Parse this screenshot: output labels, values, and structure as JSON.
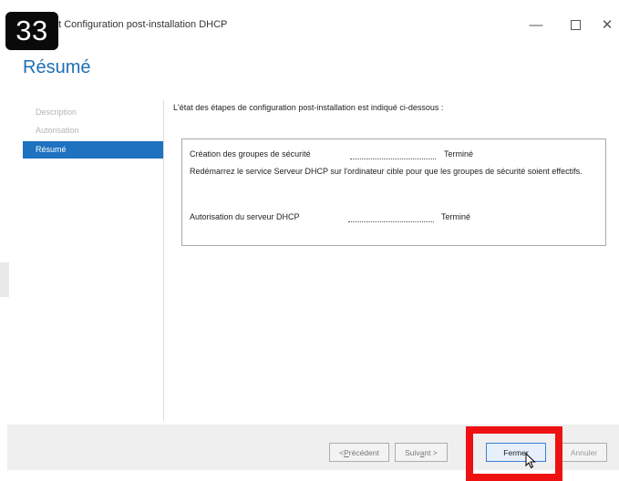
{
  "window": {
    "title": "nt Configuration post-installation DHCP",
    "controls": {
      "minimize": "—",
      "close": "✕"
    }
  },
  "badge": {
    "label": "33"
  },
  "page": {
    "title": "Résumé"
  },
  "nav": {
    "items": [
      {
        "label": "Description",
        "state": "disabled"
      },
      {
        "label": "Autorisation",
        "state": "disabled"
      },
      {
        "label": "Résumé",
        "state": "active"
      }
    ]
  },
  "content": {
    "intro": "L'état des étapes de configuration post-installation est indiqué ci-dessous :",
    "steps": [
      {
        "label": "Création des groupes de sécurité",
        "status": "Terminé"
      },
      {
        "label": "Autorisation du serveur DHCP",
        "status": "Terminé"
      }
    ],
    "note": "Redémarrez le service Serveur DHCP sur l'ordinateur cible pour que les groupes de sécurité soient effectifs."
  },
  "buttons": {
    "previous": {
      "before": "< ",
      "accel": "P",
      "after": "récédent"
    },
    "next": {
      "before": "Suiv",
      "accel": "a",
      "after": "nt >"
    },
    "close": {
      "before": "Ferme",
      "accel": "r",
      "after": ""
    },
    "cancel": "Annuler"
  },
  "colors": {
    "accent": "#1e72c0",
    "title_blue": "#1f6fb5",
    "highlight_red": "#ee1111",
    "badge_bg": "#0a0a0a"
  },
  "icons": [
    "minimize-icon",
    "maximize-icon",
    "close-icon",
    "mouse-cursor-icon"
  ]
}
